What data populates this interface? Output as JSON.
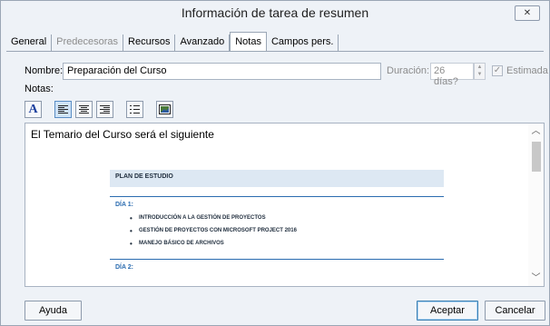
{
  "window": {
    "title": "Información de tarea de resumen",
    "close_glyph": "✕"
  },
  "tabs": [
    {
      "label": "General",
      "state": "normal"
    },
    {
      "label": "Predecesoras",
      "state": "disabled"
    },
    {
      "label": "Recursos",
      "state": "normal"
    },
    {
      "label": "Avanzado",
      "state": "normal"
    },
    {
      "label": "Notas",
      "state": "active"
    },
    {
      "label": "Campos pers.",
      "state": "normal"
    }
  ],
  "form": {
    "name_label": "Nombre:",
    "name_value": "Preparación del Curso",
    "duration_label": "Duración:",
    "duration_value": "26 días?",
    "estimated_label": "Estimada",
    "estimated_checked": true,
    "notes_label": "Notas:"
  },
  "toolbar": {
    "icons": [
      "font-icon",
      "align-left-icon",
      "align-center-icon",
      "align-right-icon",
      "bullet-list-icon",
      "insert-object-icon"
    ]
  },
  "notes": {
    "intro": "El Temario del Curso será el siguiente",
    "heading": "PLAN DE ESTUDIO",
    "day1_label": "DÍA 1:",
    "day1_items": [
      "INTRODUCCIÓN A LA GESTIÓN DE PROYECTOS",
      "GESTIÓN DE PROYECTOS CON MICROSOFT PROJECT 2016",
      "MANEJO BÁSICO DE ARCHIVOS"
    ],
    "day2_label": "DÍA 2:"
  },
  "buttons": {
    "help": "Ayuda",
    "ok": "Aceptar",
    "cancel": "Cancelar"
  },
  "colors": {
    "accent": "#2b6cb0",
    "window_bg": "#eef2f7",
    "heading_bg": "#dde8f3"
  }
}
